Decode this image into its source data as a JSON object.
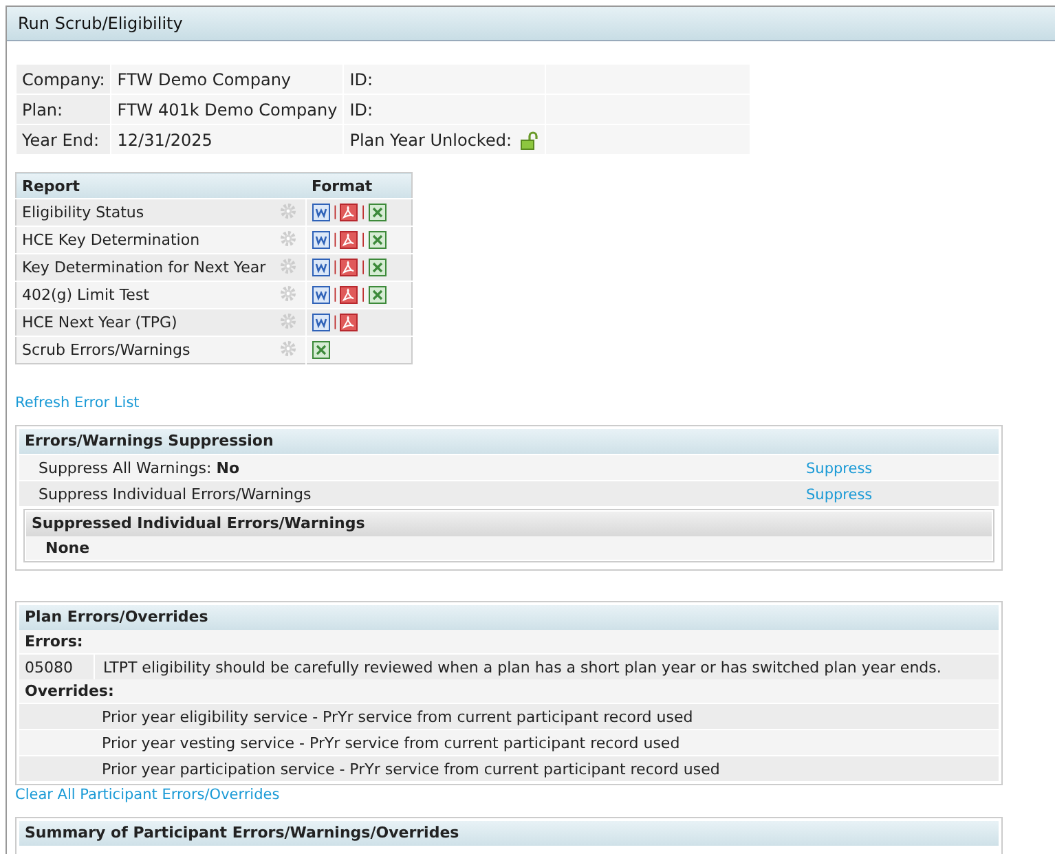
{
  "window": {
    "title": "Run Scrub/Eligibility"
  },
  "info": [
    {
      "label": "Company:",
      "value": "FTW Demo Company",
      "label_2": "ID:"
    },
    {
      "label": "Plan:",
      "value": "FTW 401k Demo Company",
      "label_2": "ID:"
    },
    {
      "label": "Year End:",
      "value": "12/31/2025",
      "label_2": "Plan Year Unlocked:",
      "unlocked": true
    }
  ],
  "reports": {
    "columns": [
      "Report",
      "Format"
    ],
    "rows": [
      {
        "name": "Eligibility Status",
        "formats": [
          {
            "kind": "word"
          },
          {
            "kind": "pdf"
          },
          {
            "kind": "excel"
          }
        ]
      },
      {
        "name": "HCE Key Determination",
        "formats": [
          {
            "kind": "word"
          },
          {
            "kind": "pdf"
          },
          {
            "kind": "excel"
          }
        ]
      },
      {
        "name": "Key Determination for Next Year",
        "formats": [
          {
            "kind": "word"
          },
          {
            "kind": "pdf"
          },
          {
            "kind": "excel"
          }
        ]
      },
      {
        "name": "402(g) Limit Test",
        "formats": [
          {
            "kind": "word"
          },
          {
            "kind": "pdf"
          },
          {
            "kind": "excel"
          }
        ]
      },
      {
        "name": "HCE Next Year (TPG)",
        "formats": [
          {
            "kind": "word"
          },
          {
            "kind": "pdf"
          }
        ]
      },
      {
        "name": "Scrub Errors/Warnings",
        "formats": [
          {
            "kind": "excel"
          }
        ]
      }
    ],
    "separator": "|"
  },
  "refresh_link": "Refresh Error List",
  "suppression": {
    "title": "Errors/Warnings Suppression",
    "rows": [
      {
        "label": "Suppress All Warnings:",
        "value": "No",
        "action": "Suppress"
      },
      {
        "label": "Suppress Individual Errors/Warnings",
        "action": "Suppress"
      }
    ],
    "suppressed": {
      "title": "Suppressed Individual Errors/Warnings",
      "empty": "None"
    }
  },
  "plan_errors": {
    "title": "Plan Errors/Overrides",
    "errors_heading": "Errors:",
    "errors": [
      {
        "code": "05080",
        "message": "LTPT eligibility should be carefully reviewed when a plan has a short plan year or has switched plan year ends."
      }
    ],
    "overrides_heading": "Overrides:",
    "overrides": [
      "Prior year eligibility service - PrYr service from current participant record used",
      "Prior year vesting service - PrYr service from current participant record used",
      "Prior year participation service - PrYr service from current participant record used"
    ]
  },
  "clear_link": "Clear All Participant Errors/Overrides",
  "summary": {
    "title": "Summary of Participant Errors/Warnings/Overrides"
  }
}
